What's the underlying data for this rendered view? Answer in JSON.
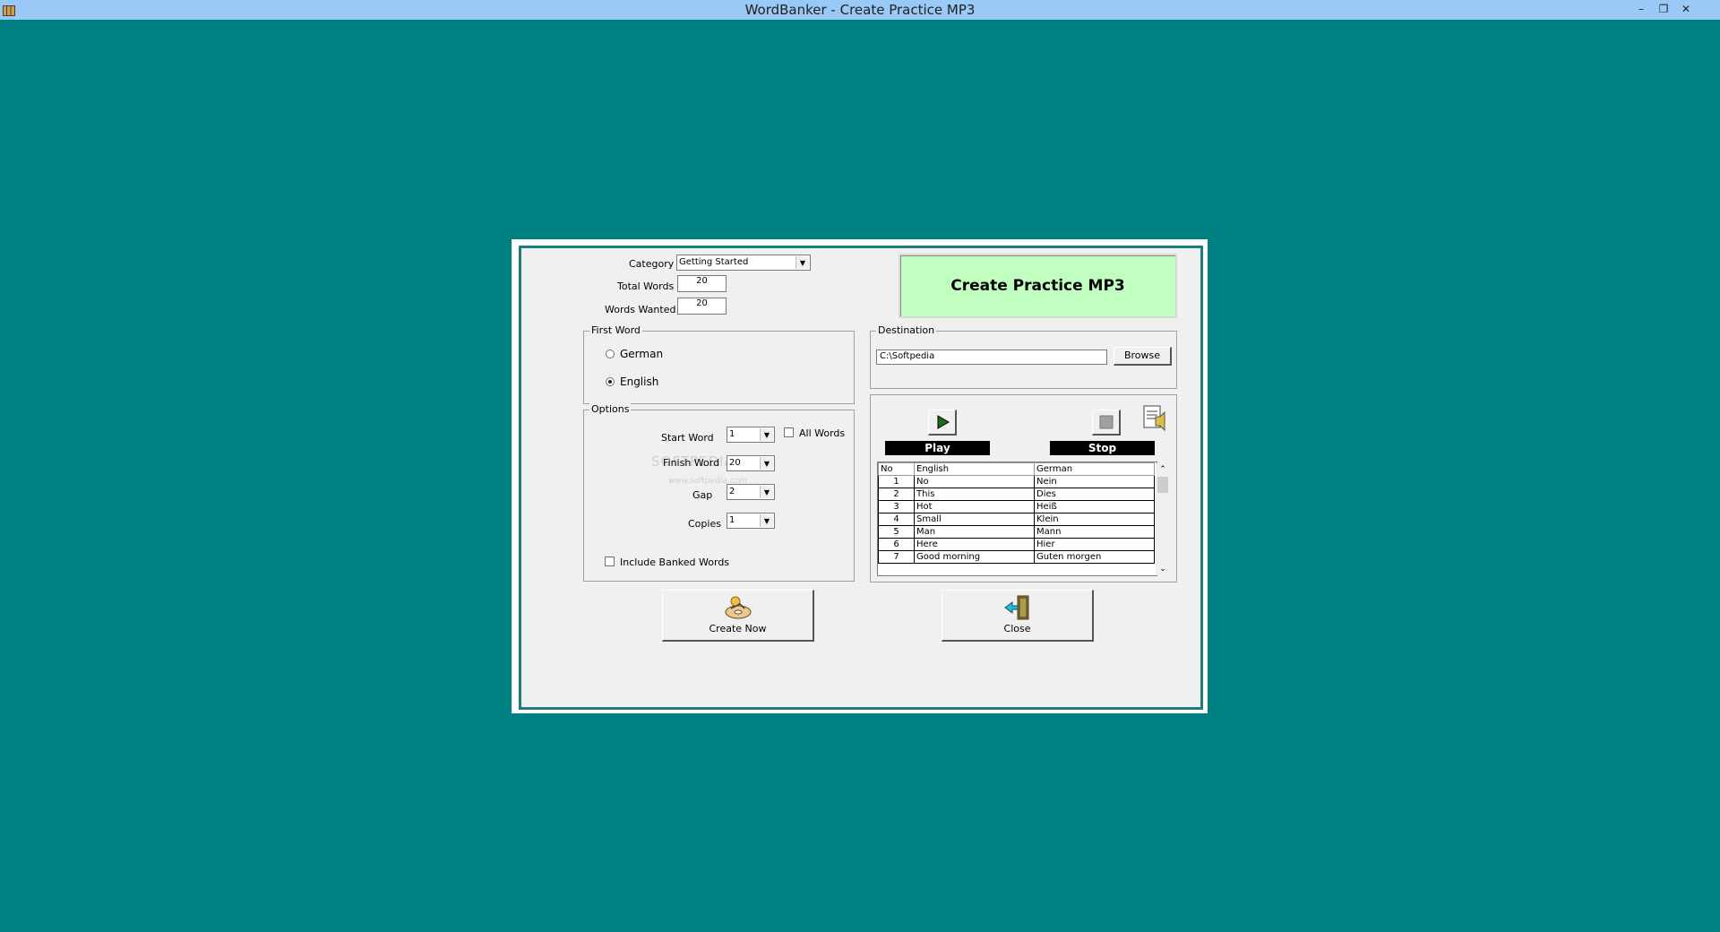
{
  "window": {
    "title": "WordBanker - Create Practice MP3"
  },
  "header": {
    "banner": "Create Practice MP3"
  },
  "form": {
    "category_label": "Category",
    "category_value": "Getting Started",
    "total_words_label": "Total Words",
    "total_words_value": "20",
    "words_wanted_label": "Words Wanted",
    "words_wanted_value": "20"
  },
  "first_word": {
    "legend": "First Word",
    "options": [
      "German",
      "English"
    ],
    "selected": "English"
  },
  "options": {
    "legend": "Options",
    "start_word_label": "Start Word",
    "start_word_value": "1",
    "all_words_label": "All Words",
    "finish_word_label": "Finish Word",
    "finish_word_value": "20",
    "gap_label": "Gap",
    "gap_value": "2",
    "copies_label": "Copies",
    "copies_value": "1",
    "include_banked_label": "Include Banked Words"
  },
  "destination": {
    "legend": "Destination",
    "path": "C:\\Softpedia",
    "browse_label": "Browse"
  },
  "media": {
    "play_label": "Play",
    "stop_label": "Stop"
  },
  "words_table": {
    "columns": [
      "No",
      "English",
      "German"
    ],
    "rows": [
      [
        "1",
        "No",
        "Nein"
      ],
      [
        "2",
        "This",
        "Dies"
      ],
      [
        "3",
        "Hot",
        "Heiß"
      ],
      [
        "4",
        "Small",
        "Klein"
      ],
      [
        "5",
        "Man",
        "Mann"
      ],
      [
        "6",
        "Here",
        "Hier"
      ],
      [
        "7",
        "Good morning",
        "Guten morgen"
      ]
    ]
  },
  "buttons": {
    "create_now_label": "Create Now",
    "close_label": "Close"
  },
  "watermark": {
    "line1": "SOFTPEDIA",
    "line2": "www.softpedia.com"
  },
  "colors": {
    "desktop": "#008080",
    "titlebar": "#99c9f6",
    "banner": "#c0ffc0",
    "frame": "#1f7d7d"
  }
}
